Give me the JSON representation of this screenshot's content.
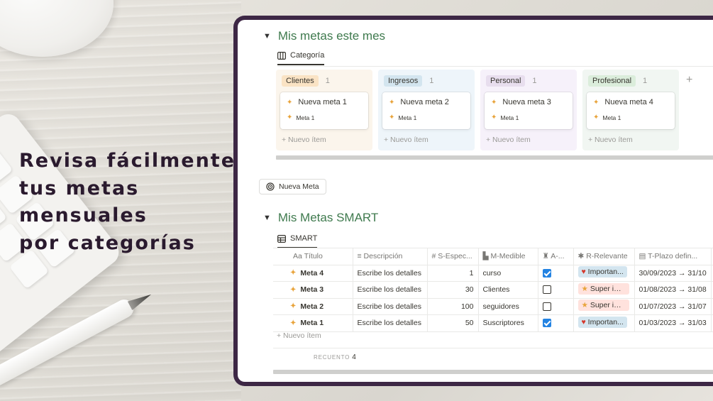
{
  "headline": [
    "Revisa fácilmente",
    "tus metas",
    "mensuales",
    "por categorías"
  ],
  "board": {
    "title": "Mis metas este mes",
    "view_tab": "Categoría",
    "columns": [
      {
        "tag": "Clientes",
        "count": "1",
        "card_title": "Nueva meta 1",
        "card_sub": "Meta 1",
        "new_item": "+ Nuevo ítem"
      },
      {
        "tag": "Ingresos",
        "count": "1",
        "card_title": "Nueva meta 2",
        "card_sub": "Meta 1",
        "new_item": "+ Nuevo ítem"
      },
      {
        "tag": "Personal",
        "count": "1",
        "card_title": "Nueva meta 3",
        "card_sub": "Meta 1",
        "new_item": "+ Nuevo ítem"
      },
      {
        "tag": "Profesional",
        "count": "1",
        "card_title": "Nueva meta 4",
        "card_sub": "Meta 1",
        "new_item": "+ Nuevo ítem"
      }
    ],
    "add_column": "+"
  },
  "new_goal_button": "Nueva Meta",
  "smart": {
    "title": "Mis Metas SMART",
    "view_tab": "SMART",
    "headers": [
      "Aa Título",
      "Descripción",
      "# S-Espec...",
      "M-Medible",
      "A-...",
      "R-Relevante",
      "T-Plazo defin...",
      ""
    ],
    "rows": [
      {
        "title": "Meta 4",
        "desc": "Escribe los detalles",
        "s": "1",
        "m": "curso",
        "a": true,
        "r": "Importan...",
        "r_kind": "heart",
        "t": "30/09/2023 → 31/10"
      },
      {
        "title": "Meta 3",
        "desc": "Escribe los detalles",
        "s": "30",
        "m": "Clientes",
        "a": false,
        "r": "Super im...",
        "r_kind": "star",
        "t": "01/08/2023 → 31/08"
      },
      {
        "title": "Meta 2",
        "desc": "Escribe los detalles",
        "s": "100",
        "m": "seguidores",
        "a": false,
        "r": "Super im...",
        "r_kind": "star",
        "t": "01/07/2023 → 31/07"
      },
      {
        "title": "Meta 1",
        "desc": "Escribe los detalles",
        "s": "50",
        "m": "Suscriptores",
        "a": true,
        "r": "Importan...",
        "r_kind": "heart",
        "t": "01/03/2023 → 31/03"
      }
    ],
    "new_row": "+ Nuevo ítem",
    "count_label": "RECUENTO",
    "count_value": "4"
  },
  "colors": {
    "frame": "#3d2745",
    "title_green": "#3f7a4e",
    "headline": "#2a1a2e",
    "check_blue": "#2383e2"
  }
}
